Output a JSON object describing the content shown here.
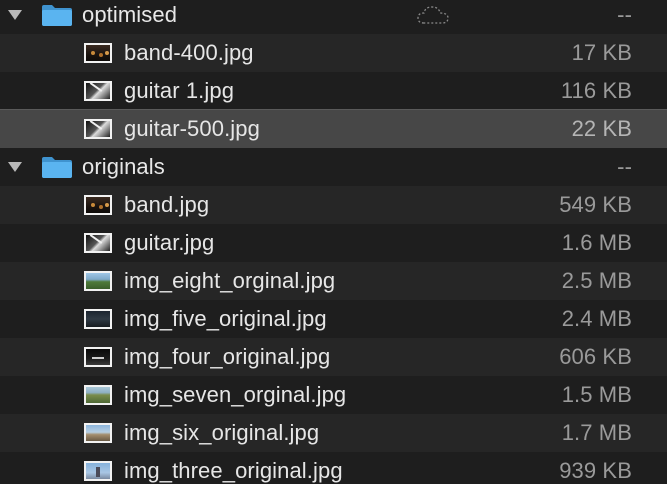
{
  "colors": {
    "background": "#1e1e1e",
    "row_alt": "#262626",
    "row_selected": "#474747",
    "folder_blue": "#59b5f0",
    "text_primary": "#e6e6e6",
    "text_secondary": "#9a9a9a"
  },
  "folders": [
    {
      "name": "optimised",
      "size": "--",
      "icon": "folder-icon",
      "status_icon": "icloud-dashed-icon",
      "expanded": true,
      "files": [
        {
          "name": "band-400.jpg",
          "size": "17 KB",
          "thumb": "band"
        },
        {
          "name": "guitar 1.jpg",
          "size": "116 KB",
          "thumb": "guitar"
        },
        {
          "name": "guitar-500.jpg",
          "size": "22 KB",
          "thumb": "guitar",
          "selected": true
        }
      ]
    },
    {
      "name": "originals",
      "size": "--",
      "icon": "folder-icon",
      "expanded": true,
      "files": [
        {
          "name": "band.jpg",
          "size": "549 KB",
          "thumb": "band"
        },
        {
          "name": "guitar.jpg",
          "size": "1.6 MB",
          "thumb": "guitar"
        },
        {
          "name": "img_eight_orginal.jpg",
          "size": "2.5 MB",
          "thumb": "land"
        },
        {
          "name": "img_five_original.jpg",
          "size": "2.4 MB",
          "thumb": "dark"
        },
        {
          "name": "img_four_original.jpg",
          "size": "606 KB",
          "thumb": "night"
        },
        {
          "name": "img_seven_orginal.jpg",
          "size": "1.5 MB",
          "thumb": "field"
        },
        {
          "name": "img_six_original.jpg",
          "size": "1.7 MB",
          "thumb": "coast"
        },
        {
          "name": "img_three_original.jpg",
          "size": "939 KB",
          "thumb": "sky"
        }
      ]
    }
  ]
}
